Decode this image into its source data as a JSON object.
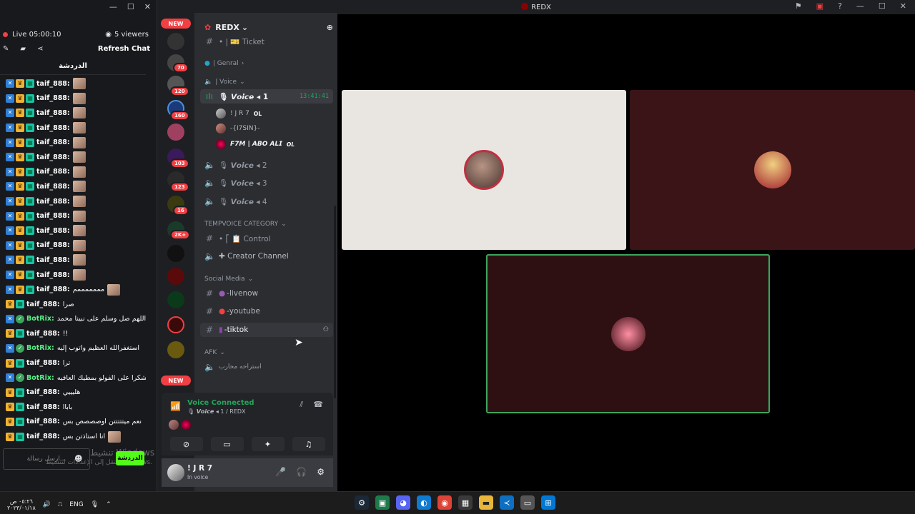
{
  "chat_panel": {
    "live_label": "Live",
    "live_time": "05:00:10",
    "viewers": "5 viewers",
    "refresh": "Refresh Chat",
    "title": "الدردشة",
    "messages": [
      {
        "user": "taif_888:",
        "text": "",
        "badges": [
          "blue",
          "gold",
          "teal"
        ],
        "thumb": true,
        "bot": false
      },
      {
        "user": "taif_888:",
        "text": "",
        "badges": [
          "blue",
          "gold",
          "teal"
        ],
        "thumb": true,
        "bot": false
      },
      {
        "user": "taif_888:",
        "text": "",
        "badges": [
          "blue",
          "gold",
          "teal"
        ],
        "thumb": true,
        "bot": false
      },
      {
        "user": "taif_888:",
        "text": "",
        "badges": [
          "blue",
          "gold",
          "teal"
        ],
        "thumb": true,
        "bot": false
      },
      {
        "user": "taif_888:",
        "text": "",
        "badges": [
          "blue",
          "gold",
          "teal"
        ],
        "thumb": true,
        "bot": false
      },
      {
        "user": "taif_888:",
        "text": "",
        "badges": [
          "blue",
          "gold",
          "teal"
        ],
        "thumb": true,
        "bot": false
      },
      {
        "user": "taif_888:",
        "text": "",
        "badges": [
          "blue",
          "gold",
          "teal"
        ],
        "thumb": true,
        "bot": false
      },
      {
        "user": "taif_888:",
        "text": "",
        "badges": [
          "blue",
          "gold",
          "teal"
        ],
        "thumb": true,
        "bot": false
      },
      {
        "user": "taif_888:",
        "text": "",
        "badges": [
          "blue",
          "gold",
          "teal"
        ],
        "thumb": true,
        "bot": false
      },
      {
        "user": "taif_888:",
        "text": "",
        "badges": [
          "blue",
          "gold",
          "teal"
        ],
        "thumb": true,
        "bot": false
      },
      {
        "user": "taif_888:",
        "text": "",
        "badges": [
          "blue",
          "gold",
          "teal"
        ],
        "thumb": true,
        "bot": false
      },
      {
        "user": "taif_888:",
        "text": "",
        "badges": [
          "blue",
          "gold",
          "teal"
        ],
        "thumb": true,
        "bot": false
      },
      {
        "user": "taif_888:",
        "text": "",
        "badges": [
          "blue",
          "gold",
          "teal"
        ],
        "thumb": true,
        "bot": false
      },
      {
        "user": "taif_888:",
        "text": "",
        "badges": [
          "blue",
          "gold",
          "teal"
        ],
        "thumb": true,
        "bot": false
      },
      {
        "user": "taif_888:",
        "text": "مممممممم",
        "badges": [
          "blue",
          "gold",
          "teal"
        ],
        "thumb": true,
        "bot": false
      },
      {
        "user": "taif_888:",
        "text": "صرا",
        "badges": [
          "gold",
          "teal"
        ],
        "thumb": false,
        "bot": false
      },
      {
        "user": "BotRix:",
        "text": "اللهم صل وسلم على نبينا محمد",
        "badges": [
          "blue",
          "green"
        ],
        "thumb": false,
        "bot": true
      },
      {
        "user": "taif_888:",
        "text": "!!",
        "badges": [
          "gold",
          "teal"
        ],
        "thumb": false,
        "bot": false
      },
      {
        "user": "BotRix:",
        "text": "استغفرالله العظيم واتوب إليه",
        "badges": [
          "blue",
          "green"
        ],
        "thumb": false,
        "bot": true
      },
      {
        "user": "taif_888:",
        "text": "ترا",
        "badges": [
          "gold",
          "teal"
        ],
        "thumb": false,
        "bot": false
      },
      {
        "user": "BotRix:",
        "text": "شكرا على الفولو بمطيك العافيه",
        "badges": [
          "blue",
          "green"
        ],
        "thumb": false,
        "bot": true
      },
      {
        "user": "taif_888:",
        "text": "هليييي",
        "badges": [
          "gold",
          "teal"
        ],
        "thumb": false,
        "bot": false
      },
      {
        "user": "taif_888:",
        "text": "باباا",
        "badges": [
          "gold",
          "teal"
        ],
        "thumb": false,
        "bot": false
      },
      {
        "user": "taif_888:",
        "text": "نعم ميتتتتتن اوصصصص بس",
        "badges": [
          "gold",
          "teal"
        ],
        "thumb": false,
        "bot": false
      },
      {
        "user": "taif_888:",
        "text": "انا استاذتن بس",
        "badges": [
          "gold",
          "teal"
        ],
        "thumb": true,
        "bot": false
      }
    ],
    "input_placeholder": "ارسل رسالة...",
    "send_label": "الدردشة",
    "watermark_1": "تنشيط Windows",
    "watermark_2": "انتقل إلى الإعدادات لتنشيط Windows."
  },
  "rail": {
    "new_label": "NEW",
    "badges": [
      "70",
      "120",
      "160",
      "103",
      "123",
      "16",
      "2K+"
    ]
  },
  "server": {
    "name": "REDX",
    "channels_top": [
      {
        "icon": "#",
        "label": "• | 🎫 Ticket"
      }
    ],
    "categories": {
      "genral": "| Genral",
      "voice": "| Voice",
      "tempvoice": "TEMPVOICE CATEGORY",
      "social": "Social Media",
      "afk": "AFK"
    },
    "voice_channels": [
      {
        "label": "🎙 𝙑𝙤𝙞𝙘𝙚 ◂ 1",
        "time": "13:41:41",
        "active": true
      },
      {
        "label": "🎙 𝙑𝙤𝙞𝙘𝙚 ◂ 2",
        "time": "",
        "active": false
      },
      {
        "label": "🎙 𝙑𝙤𝙞𝙘𝙚 ◂ 3",
        "time": "",
        "active": false
      },
      {
        "label": "🎙 𝙑𝙤𝙞𝙘𝙚 ◂ 4",
        "time": "",
        "active": false
      }
    ],
    "voice_users": [
      {
        "name": "! J R 7",
        "tag": "OL"
      },
      {
        "name": "-{I7SIN}-",
        "tag": ""
      },
      {
        "name": "F7M | 𝘼𝘽𝙊 𝘼𝙇𝙄",
        "tag": "OL"
      }
    ],
    "temp_channels": [
      {
        "icon": "#",
        "label": "• ⎡ 📋 Control"
      },
      {
        "icon": "🔊",
        "label": "✚ Creator Channel"
      }
    ],
    "social_channels": [
      {
        "label": "-livenow"
      },
      {
        "label": "-youtube"
      },
      {
        "label": "-tiktok"
      }
    ],
    "afk_channel": "استراحه محارب"
  },
  "voice_status": {
    "title": "Voice Connected",
    "subtitle": "🎙 𝙑𝙤𝙞𝙘𝙚 ◂ 1 / REDX"
  },
  "user": {
    "name": "! J R 7",
    "status": "In voice"
  },
  "window": {
    "title": "REDX"
  },
  "taskbar": {
    "time": "٠٥:٢٦ ص",
    "date": "٢٠٢٣/٠١/١٨",
    "lang": "ENG"
  }
}
